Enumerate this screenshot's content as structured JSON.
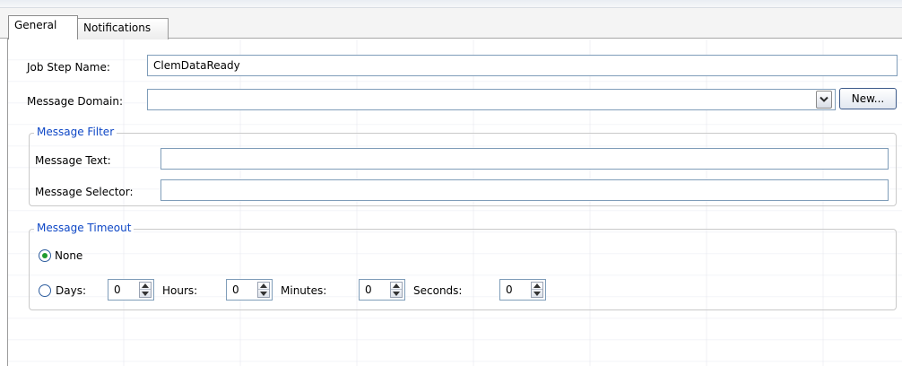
{
  "tabs": [
    {
      "label": "General",
      "active": true
    },
    {
      "label": "Notifications",
      "active": false
    }
  ],
  "job_step": {
    "label": "Job Step Name:",
    "value": "ClemDataReady"
  },
  "message_domain": {
    "label": "Message Domain:",
    "value": "",
    "dropdown_icon": "chevron-down-icon",
    "new_button": "New..."
  },
  "message_filter": {
    "legend": "Message Filter",
    "text_label": "Message Text:",
    "text_value": "",
    "selector_label": "Message Selector:",
    "selector_value": ""
  },
  "message_timeout": {
    "legend": "Message Timeout",
    "none_label": "None",
    "none_selected": true,
    "days_label": "Days:",
    "days_value": "0",
    "hours_label": "Hours:",
    "hours_value": "0",
    "minutes_label": "Minutes:",
    "minutes_value": "0",
    "seconds_label": "Seconds:",
    "seconds_value": "0"
  },
  "colors": {
    "legend": "#0e47c6",
    "border": "#7f9db9",
    "radio_dot": "#1f9b2e"
  }
}
